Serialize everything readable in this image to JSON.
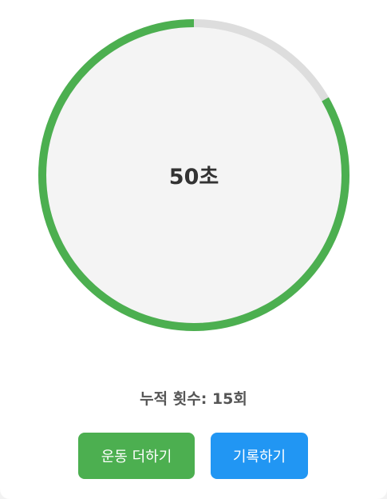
{
  "timer": {
    "label": "50초",
    "elapsed_seconds": 50,
    "total_seconds": 60,
    "progress_color": "#4caf50",
    "track_color": "#dddddd",
    "fill_color": "#f4f4f4"
  },
  "count": {
    "text": "누적 횟수: 15회"
  },
  "buttons": {
    "add": {
      "label": "운동 더하기",
      "color": "#4caf50"
    },
    "record": {
      "label": "기록하기",
      "color": "#2196f3"
    }
  }
}
